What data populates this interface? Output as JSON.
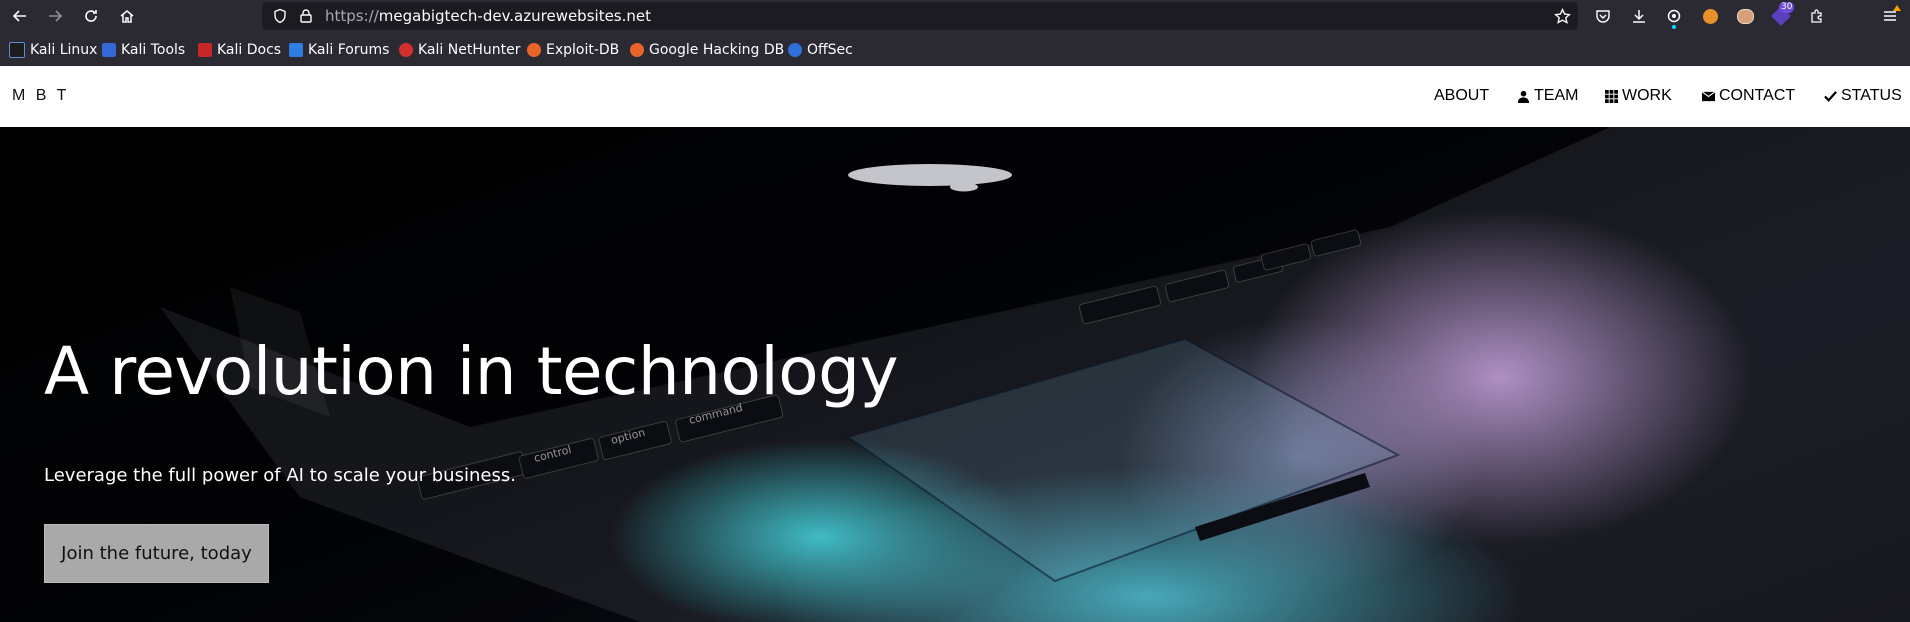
{
  "browser": {
    "url_prefix": "https://",
    "url_host": "megabigtech-dev.azurewebsites.net",
    "extension_badge": "30",
    "bookmarks": [
      {
        "label": "Kali Linux"
      },
      {
        "label": "Kali Tools"
      },
      {
        "label": "Kali Docs"
      },
      {
        "label": "Kali Forums"
      },
      {
        "label": "Kali NetHunter"
      },
      {
        "label": "Exploit-DB"
      },
      {
        "label": "Google Hacking DB"
      },
      {
        "label": "OffSec"
      }
    ]
  },
  "site": {
    "brand": "M B T",
    "nav": [
      {
        "label": "ABOUT",
        "icon": "none"
      },
      {
        "label": "TEAM",
        "icon": "user-icon"
      },
      {
        "label": "WORK",
        "icon": "grid-icon"
      },
      {
        "label": "CONTACT",
        "icon": "envelope-icon"
      },
      {
        "label": "STATUS",
        "icon": "check-icon"
      }
    ]
  },
  "hero": {
    "title": "A revolution in technology",
    "subtitle": "Leverage the full power of AI to scale your business.",
    "cta": "Join the future, today",
    "key_labels": [
      "control",
      "option",
      "command"
    ]
  },
  "colors": {
    "toolbar": "#2b2a33",
    "urlbar": "#1c1b22",
    "cta_bg": "#a9a9a9"
  }
}
